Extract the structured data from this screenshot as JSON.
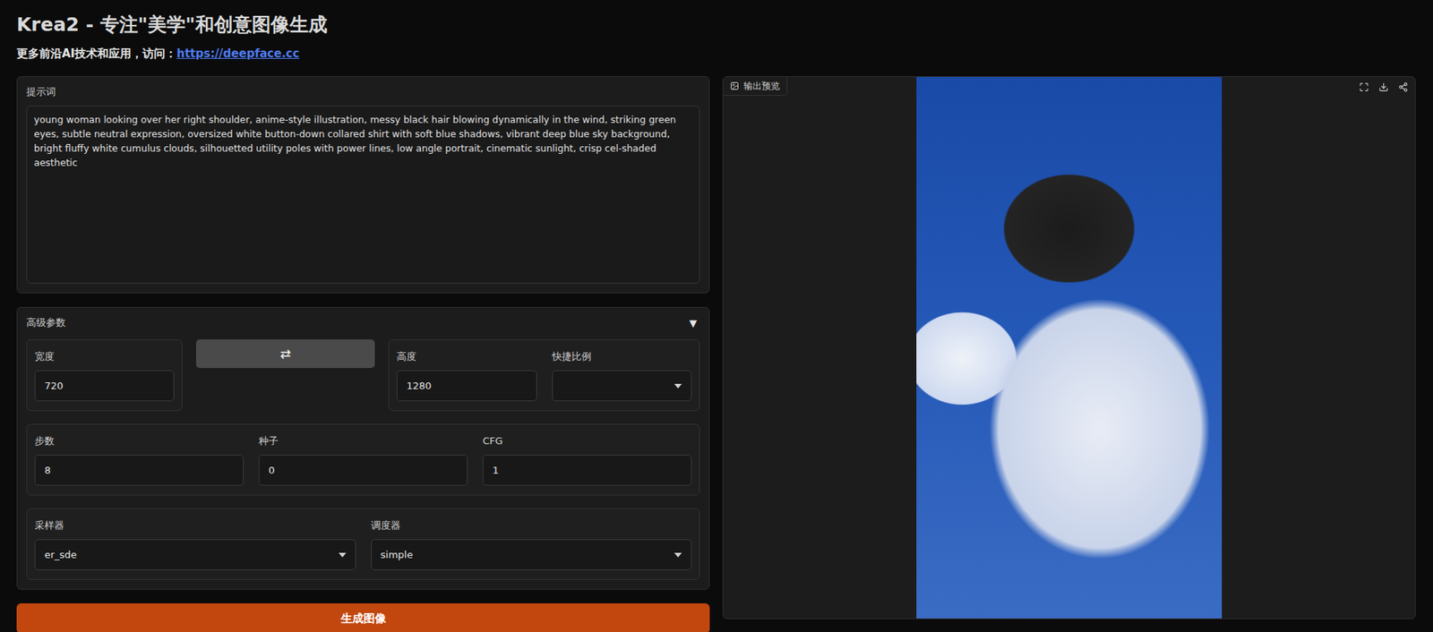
{
  "title": "Krea2 - 专注\"美学\"和创意图像生成",
  "subtitle": {
    "text": "更多前沿AI技术和应用，访问：",
    "link": "https://deepface.cc"
  },
  "prompt": {
    "label": "提示词",
    "value": "young woman looking over her right shoulder, anime-style illustration, messy black hair blowing dynamically in the wind, striking green eyes, subtle neutral expression, oversized white button-down collared shirt with soft blue shadows, vibrant deep blue sky background, bright fluffy white cumulus clouds, silhouetted utility poles with power lines, low angle portrait, cinematic sunlight, crisp cel-shaded aesthetic"
  },
  "advanced": {
    "label": "高级参数",
    "toggle": "▼",
    "expanded": true,
    "size": {
      "width": {
        "label": "宽度",
        "value": "720",
        "kind": "input"
      },
      "swap": "⇄",
      "height": {
        "label": "高度",
        "value": "1280",
        "kind": "input"
      },
      "ratio": {
        "label": "快捷比例",
        "value": "",
        "kind": "select"
      }
    },
    "rows": [
      [
        {
          "label": "步数",
          "value": "8",
          "kind": "input"
        },
        {
          "label": "种子",
          "value": "0",
          "kind": "input"
        },
        {
          "label": "CFG",
          "value": "1",
          "kind": "input"
        }
      ],
      [
        {
          "label": "采样器",
          "value": "er_sde",
          "kind": "select"
        },
        {
          "label": "调度器",
          "value": "simple",
          "kind": "select"
        }
      ]
    ]
  },
  "generate_button": "生成图像",
  "output": {
    "label": "输出预览"
  }
}
